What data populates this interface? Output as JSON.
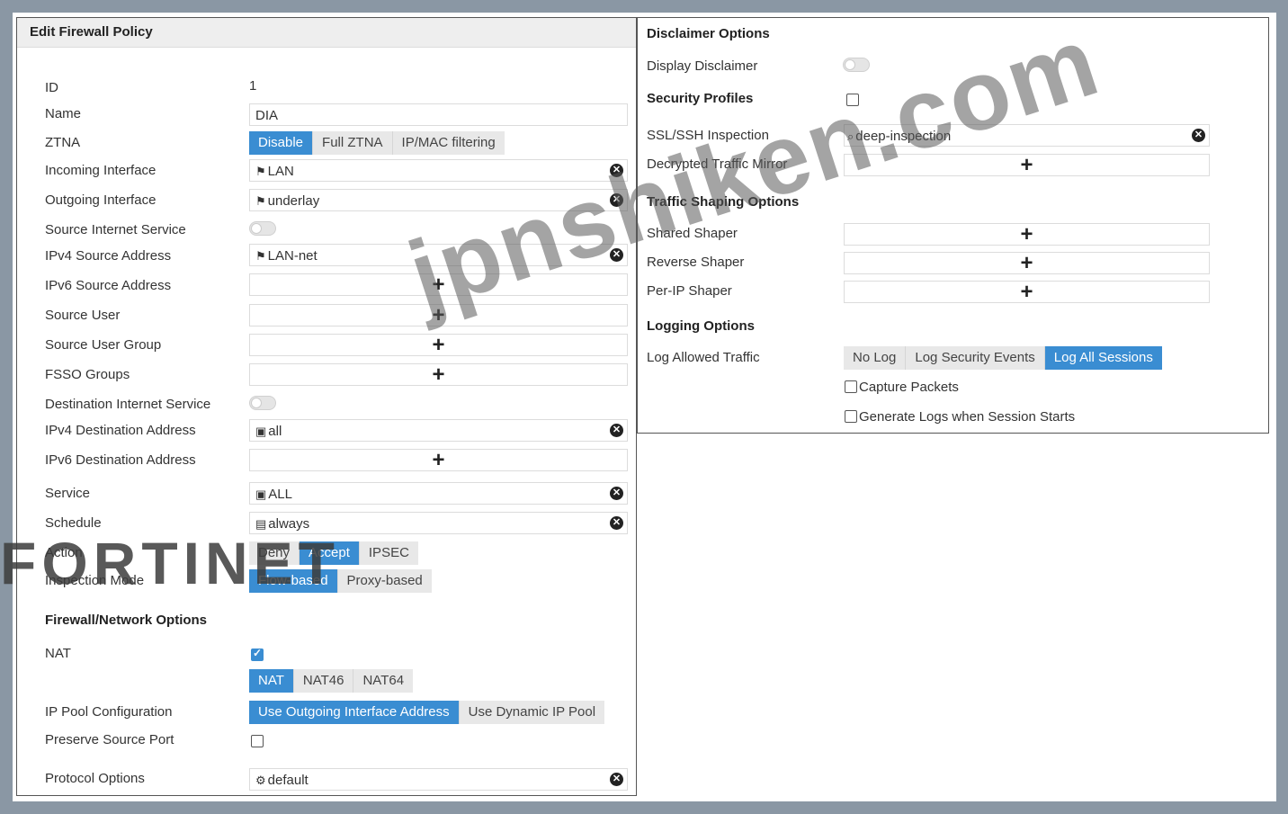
{
  "left": {
    "title": "Edit Firewall Policy",
    "id_label": "ID",
    "id_value": "1",
    "name_label": "Name",
    "name_value": "DIA",
    "ztna_label": "ZTNA",
    "ztna_options": [
      "Disable",
      "Full ZTNA",
      "IP/MAC filtering"
    ],
    "ztna_selected": "Disable",
    "incoming_label": "Incoming Interface",
    "incoming_value": "LAN",
    "outgoing_label": "Outgoing Interface",
    "outgoing_value": "underlay",
    "src_inet_label": "Source Internet Service",
    "ipv4_src_label": "IPv4 Source Address",
    "ipv4_src_value": "LAN-net",
    "ipv6_src_label": "IPv6 Source Address",
    "src_user_label": "Source User",
    "src_user_group_label": "Source User Group",
    "fsso_label": "FSSO Groups",
    "dst_inet_label": "Destination Internet Service",
    "ipv4_dst_label": "IPv4 Destination Address",
    "ipv4_dst_value": "all",
    "ipv6_dst_label": "IPv6 Destination Address",
    "service_label": "Service",
    "service_value": "ALL",
    "schedule_label": "Schedule",
    "schedule_value": "always",
    "action_label": "Action",
    "action_options": [
      "Deny",
      "Accept",
      "IPSEC"
    ],
    "action_selected": "Accept",
    "inspection_label": "Inspection Mode",
    "inspection_options": [
      "Flow-based",
      "Proxy-based"
    ],
    "inspection_selected": "Flow-based",
    "fw_section": "Firewall/Network Options",
    "nat_label": "NAT",
    "nat_checked": true,
    "nat_options": [
      "NAT",
      "NAT46",
      "NAT64"
    ],
    "nat_selected": "NAT",
    "ippool_label": "IP Pool Configuration",
    "ippool_options": [
      "Use Outgoing Interface Address",
      "Use Dynamic IP Pool"
    ],
    "ippool_selected": "Use Outgoing Interface Address",
    "preserve_label": "Preserve Source Port",
    "preserve_checked": false,
    "protocol_label": "Protocol Options",
    "protocol_value": "default"
  },
  "right": {
    "disclaimer_section": "Disclaimer Options",
    "display_disclaimer_label": "Display Disclaimer",
    "security_profiles_section": "Security Profiles",
    "ssl_label": "SSL/SSH Inspection",
    "ssl_value": "deep-inspection",
    "mirror_label": "Decrypted Traffic Mirror",
    "shaping_section": "Traffic Shaping Options",
    "shared_shaper_label": "Shared Shaper",
    "reverse_shaper_label": "Reverse Shaper",
    "perip_shaper_label": "Per-IP Shaper",
    "logging_section": "Logging Options",
    "log_allowed_label": "Log Allowed Traffic",
    "log_options": [
      "No Log",
      "Log Security Events",
      "Log All Sessions"
    ],
    "log_selected": "Log All Sessions",
    "capture_label": "Capture Packets",
    "gen_logs_label": "Generate Logs when Session Starts"
  },
  "overlay": {
    "watermark": "jpnshiken.com",
    "logo": "FORTINET"
  },
  "colors": {
    "accent": "#3a8dd2",
    "frame": "#8a97a4"
  },
  "icons": [
    "interface-icon",
    "address-icon",
    "service-icon",
    "schedule-icon",
    "profile-icon",
    "inspection-icon",
    "close-icon",
    "plus-icon"
  ]
}
